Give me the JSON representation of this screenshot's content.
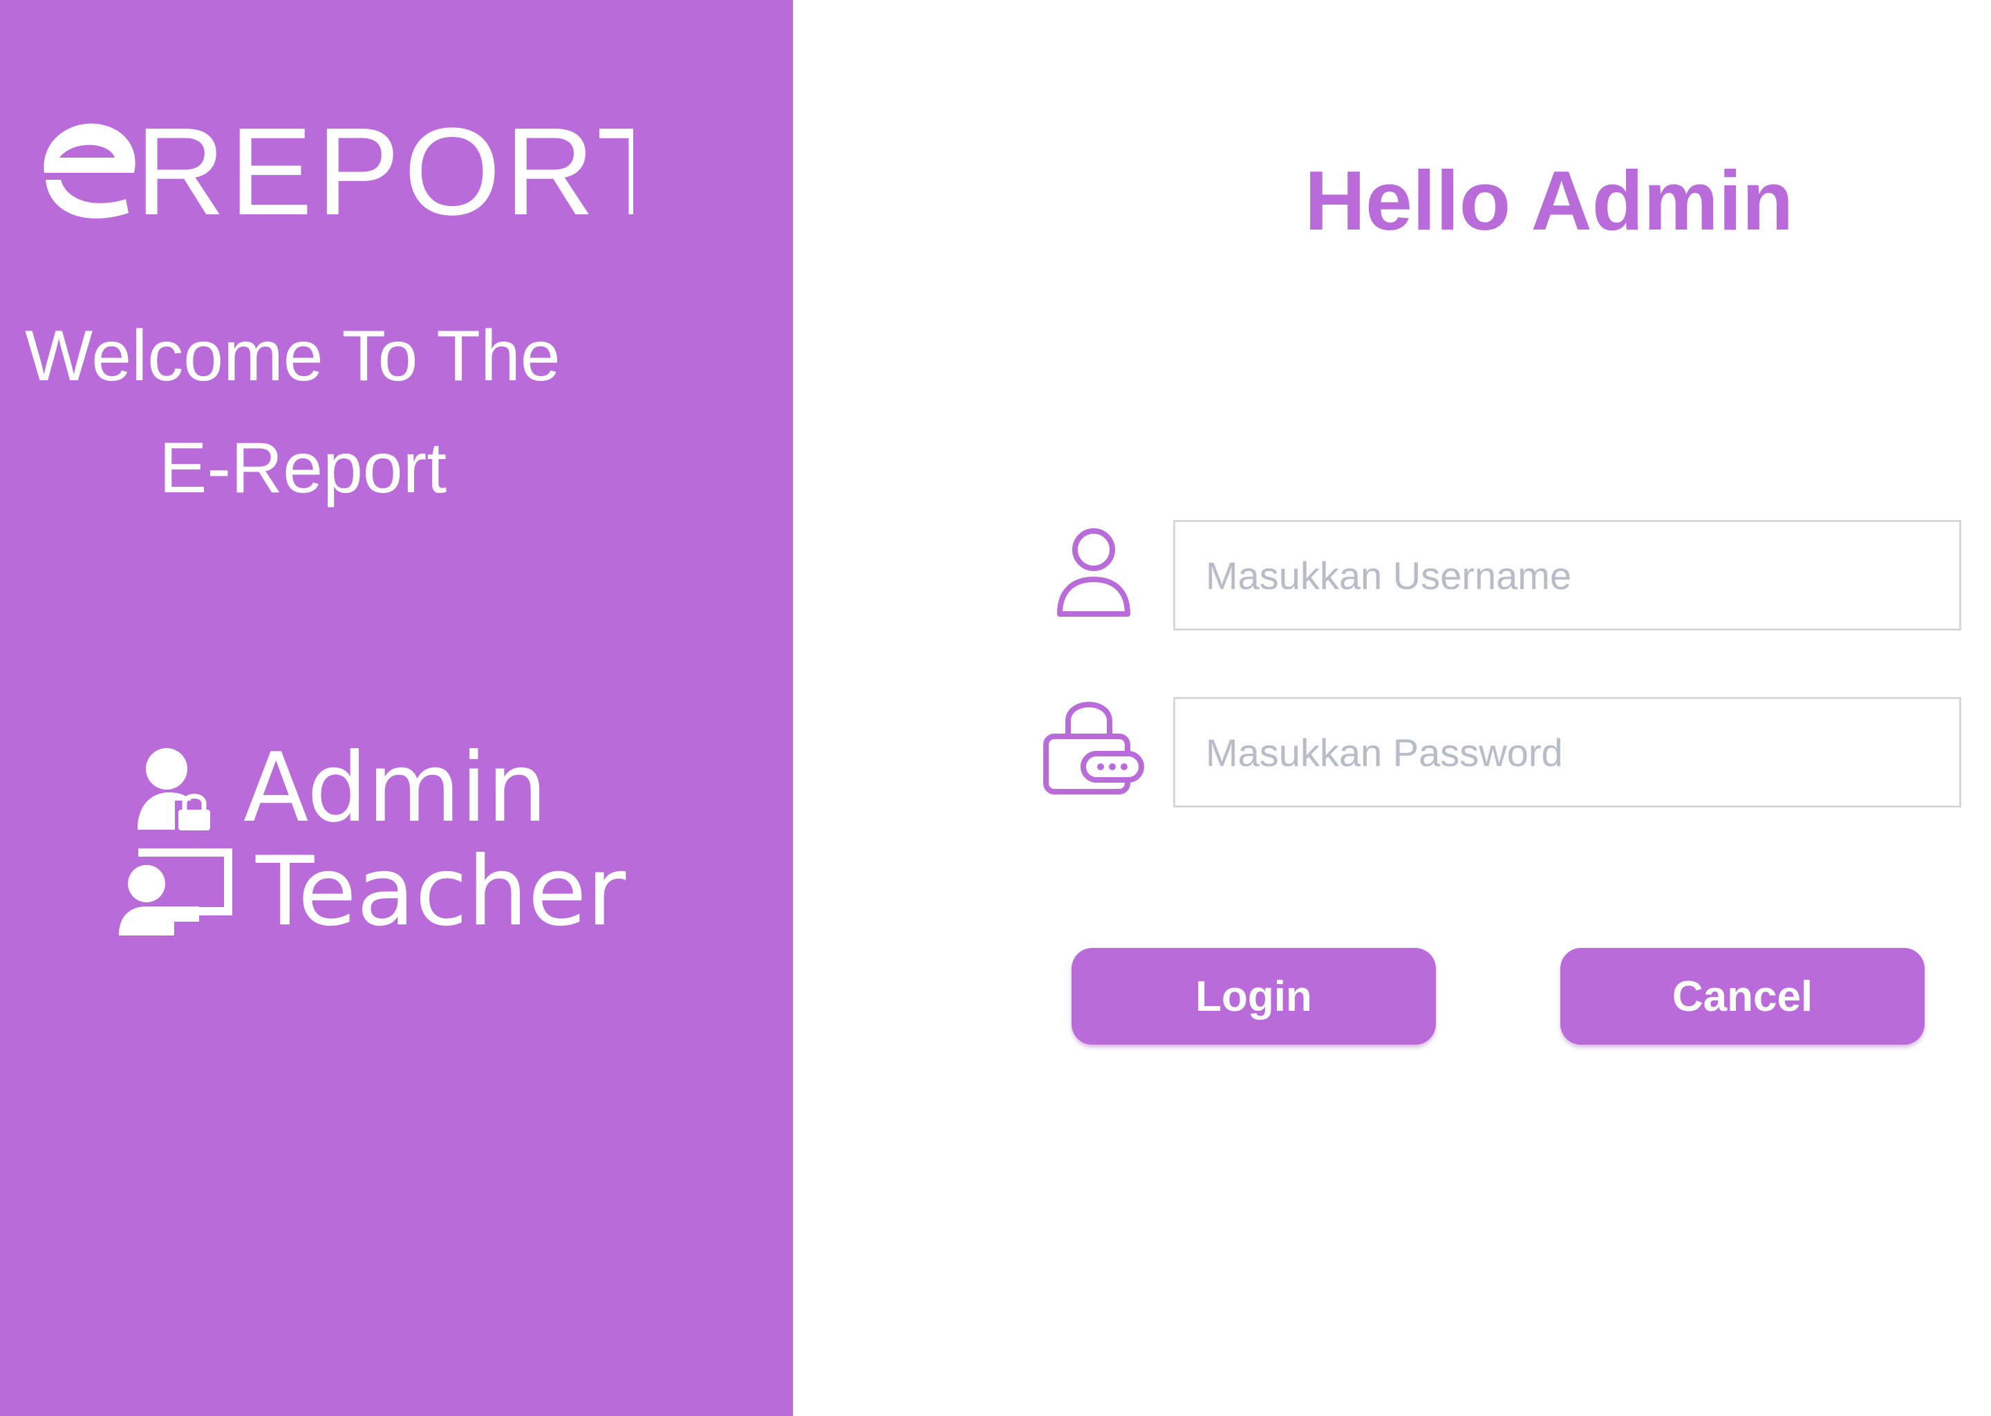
{
  "left_panel": {
    "logo_alt": "eREPORT",
    "welcome_line1": "Welcome To The",
    "welcome_line2": "E-Report",
    "roles": [
      {
        "label": "Admin",
        "icon": "admin-user-lock-icon"
      },
      {
        "label": "Teacher",
        "icon": "teacher-board-icon"
      }
    ]
  },
  "login_form": {
    "title": "Hello Admin",
    "username": {
      "value": "",
      "placeholder": "Masukkan Username",
      "icon": "user-icon"
    },
    "password": {
      "value": "",
      "placeholder": "Masukkan Password",
      "icon": "lock-password-icon"
    },
    "login_label": "Login",
    "cancel_label": "Cancel"
  },
  "colors": {
    "accent": "#ba6bda",
    "background": "#ffffff",
    "input_border": "#d8d8d8",
    "placeholder": "#b8bcc6"
  }
}
